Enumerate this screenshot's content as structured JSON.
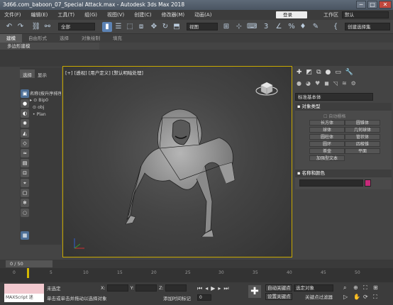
{
  "window": {
    "title": "3d66.com_baboon_07_Special Attack.max - Autodesk 3ds Max 2018",
    "min": "─",
    "max": "□",
    "close": "✕"
  },
  "menu": [
    "文件(F)",
    "编辑(E)",
    "工具(T)",
    "组(G)",
    "视图(V)",
    "创建(C)",
    "修改器(M)",
    "动画(A)"
  ],
  "login": "登录",
  "workspace": {
    "label": "工作区",
    "value": "默认"
  },
  "toolbar": {
    "filter": "全部",
    "ref_system": "视图",
    "selection_set": "创建选择集"
  },
  "ribbon": {
    "tabs": [
      "建模",
      "自由形式",
      "选择",
      "对象绘制",
      "填充"
    ],
    "active": "建模",
    "sub": "多边形建模"
  },
  "scene_explorer": {
    "tabs": [
      "选择",
      "显示"
    ],
    "header": "名称(按升序排序)",
    "items": [
      "Bip0",
      "obj",
      "Plan"
    ]
  },
  "viewport": {
    "label": "[+] [透视] [用户定义] [默认明暗处理]"
  },
  "command_panel": {
    "dropdown": "标准基本体",
    "object_type": {
      "title": "对象类型",
      "auto_grid": "自动栅格",
      "buttons": [
        "长方体",
        "圆锥体",
        "球体",
        "几何球体",
        "圆柱体",
        "管状体",
        "圆环",
        "四棱锥",
        "茶壶",
        "平面",
        "加强型文本"
      ]
    },
    "name_color": {
      "title": "名称和颜色",
      "color": "#c72a7a"
    }
  },
  "time": {
    "slider": "0 / 50",
    "ticks": [
      "0",
      "5",
      "10",
      "15",
      "20",
      "25",
      "30",
      "35",
      "40",
      "45",
      "50"
    ]
  },
  "status": {
    "maxscript": "MAXScript 迷",
    "line1": "未选定",
    "line2": "单击或单击并拖动以选择对象",
    "x_label": "X:",
    "y_label": "Y:",
    "z_label": "Z:",
    "x_val": "",
    "y_val": "",
    "z_val": "",
    "add_time_tag": "添加时间标记",
    "frame": "0",
    "auto_key": "自动关键点",
    "set_key": "设置关键点",
    "selected_object": "选定对象",
    "key_filter": "关键点过滤器"
  }
}
